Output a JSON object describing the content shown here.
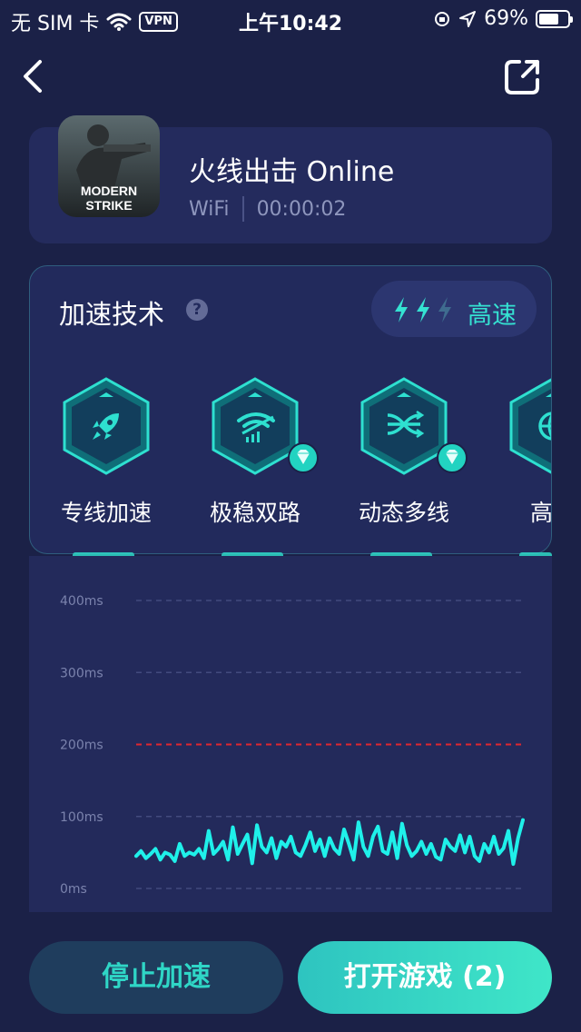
{
  "status_bar": {
    "carrier": "无 SIM 卡",
    "vpn": "VPN",
    "time": "上午10:42",
    "battery": "69%",
    "battery_level": 0.69
  },
  "nav": {
    "back_icon": "chevron-left-icon",
    "share_icon": "share-external-icon"
  },
  "game": {
    "title": "火线出击 Online",
    "network": "WiFi",
    "timer": "00:00:02",
    "icon_text_top": "MODERN",
    "icon_text_bottom": "STRIKE"
  },
  "tech": {
    "title": "加速技术",
    "help": "?",
    "speed_label": "高速",
    "speed_level": 2,
    "speed_max": 3,
    "features": [
      {
        "label": "专线加速",
        "icon": "rocket-icon",
        "premium": false
      },
      {
        "label": "极稳双路",
        "icon": "wifi-dual-icon",
        "premium": true
      },
      {
        "label": "动态多线",
        "icon": "multi-line-icon",
        "premium": true
      },
      {
        "label": "高速",
        "icon": "globe-icon",
        "premium": false
      }
    ]
  },
  "chart_data": {
    "type": "line",
    "y_ticks": [
      "400ms",
      "300ms",
      "200ms",
      "100ms",
      "0ms"
    ],
    "y_tick_values": [
      400,
      300,
      200,
      100,
      0
    ],
    "ylim": [
      0,
      400
    ],
    "threshold": 200,
    "threshold_color": "#e0262f",
    "line_color": "#1ff0ea",
    "grid": true,
    "values": [
      45,
      52,
      42,
      48,
      55,
      40,
      50,
      47,
      38,
      62,
      45,
      50,
      47,
      55,
      42,
      80,
      48,
      55,
      65,
      40,
      85,
      48,
      62,
      75,
      35,
      88,
      58,
      50,
      70,
      42,
      65,
      58,
      72,
      50,
      45,
      60,
      78,
      52,
      68,
      45,
      70,
      55,
      48,
      82,
      62,
      40,
      92,
      58,
      45,
      72,
      86,
      52,
      48,
      78,
      42,
      90,
      60,
      45,
      52,
      65,
      48,
      62,
      44,
      40,
      68,
      58,
      52,
      74,
      50,
      72,
      45,
      38,
      62,
      50,
      72,
      48,
      56,
      80,
      34,
      70,
      95
    ]
  },
  "buttons": {
    "stop": "停止加速",
    "open": "打开游戏 (2)"
  },
  "colors": {
    "background": "#1b2147",
    "accent": "#35e2d2",
    "card": "#242b5d"
  }
}
